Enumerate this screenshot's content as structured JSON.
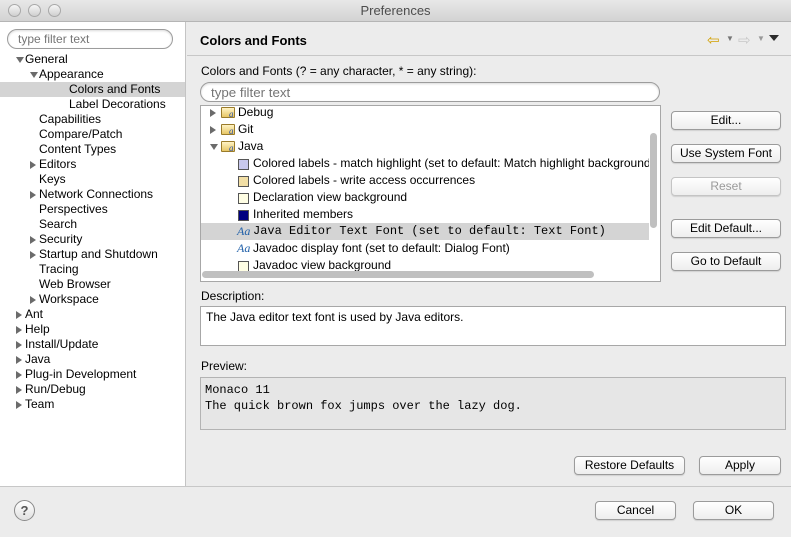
{
  "window": {
    "title": "Preferences"
  },
  "left": {
    "filter_placeholder": "type filter text",
    "tree": [
      {
        "label": "General",
        "twisty": "open",
        "depth": 0
      },
      {
        "label": "Appearance",
        "twisty": "open",
        "depth": 1
      },
      {
        "label": "Colors and Fonts",
        "twisty": "none",
        "depth": 2,
        "selected": true
      },
      {
        "label": "Label Decorations",
        "twisty": "none",
        "depth": 2
      },
      {
        "label": "Capabilities",
        "twisty": "none",
        "depth": 1
      },
      {
        "label": "Compare/Patch",
        "twisty": "none",
        "depth": 1
      },
      {
        "label": "Content Types",
        "twisty": "none",
        "depth": 1
      },
      {
        "label": "Editors",
        "twisty": "closed",
        "depth": 1
      },
      {
        "label": "Keys",
        "twisty": "none",
        "depth": 1
      },
      {
        "label": "Network Connections",
        "twisty": "closed",
        "depth": 1
      },
      {
        "label": "Perspectives",
        "twisty": "none",
        "depth": 1
      },
      {
        "label": "Search",
        "twisty": "none",
        "depth": 1
      },
      {
        "label": "Security",
        "twisty": "closed",
        "depth": 1
      },
      {
        "label": "Startup and Shutdown",
        "twisty": "closed",
        "depth": 1
      },
      {
        "label": "Tracing",
        "twisty": "none",
        "depth": 1
      },
      {
        "label": "Web Browser",
        "twisty": "none",
        "depth": 1
      },
      {
        "label": "Workspace",
        "twisty": "closed",
        "depth": 1
      },
      {
        "label": "Ant",
        "twisty": "closed",
        "depth": 0
      },
      {
        "label": "Help",
        "twisty": "closed",
        "depth": 0
      },
      {
        "label": "Install/Update",
        "twisty": "closed",
        "depth": 0
      },
      {
        "label": "Java",
        "twisty": "closed",
        "depth": 0
      },
      {
        "label": "Plug-in Development",
        "twisty": "closed",
        "depth": 0
      },
      {
        "label": "Run/Debug",
        "twisty": "closed",
        "depth": 0
      },
      {
        "label": "Team",
        "twisty": "closed",
        "depth": 0
      }
    ]
  },
  "page": {
    "title": "Colors and Fonts",
    "filter_label": "Colors and Fonts (? = any character, * = any string):",
    "filter_placeholder": "type filter text",
    "list": [
      {
        "kind": "folder",
        "label": "Debug",
        "twisty": "closed"
      },
      {
        "kind": "folder",
        "label": "Git",
        "twisty": "closed"
      },
      {
        "kind": "folder",
        "label": "Java",
        "twisty": "open"
      },
      {
        "kind": "color",
        "label": "Colored labels - match highlight (set to default: Match highlight background)",
        "color": "#c8c8ec"
      },
      {
        "kind": "color",
        "label": "Colored labels - write access occurrences",
        "color": "#f2dfa6"
      },
      {
        "kind": "color",
        "label": "Declaration view background",
        "color": "#fffee4"
      },
      {
        "kind": "color",
        "label": "Inherited members",
        "color": "#000080"
      },
      {
        "kind": "font",
        "label": "Java Editor Text Font (set to default: Text Font)",
        "mono": true,
        "selected": true
      },
      {
        "kind": "font",
        "label": "Javadoc display font (set to default: Dialog Font)",
        "mono": false
      },
      {
        "kind": "color",
        "label": "Javadoc view background",
        "color": "#fffee4"
      }
    ],
    "buttons": {
      "edit": "Edit...",
      "use_system_font": "Use System Font",
      "reset": "Reset",
      "edit_default": "Edit Default...",
      "go_to_default": "Go to Default"
    },
    "description_label": "Description:",
    "description_text": "The Java editor text font is used by Java editors.",
    "preview_label": "Preview:",
    "preview_lines": [
      "Monaco 11",
      "The quick brown fox jumps over the lazy dog."
    ],
    "restore_defaults": "Restore Defaults",
    "apply": "Apply"
  },
  "footer": {
    "cancel": "Cancel",
    "ok": "OK",
    "help": "?"
  },
  "icons": [
    "back-arrow-icon",
    "forward-arrow-icon",
    "view-menu-icon",
    "help-icon",
    "folder-icon",
    "font-icon"
  ]
}
